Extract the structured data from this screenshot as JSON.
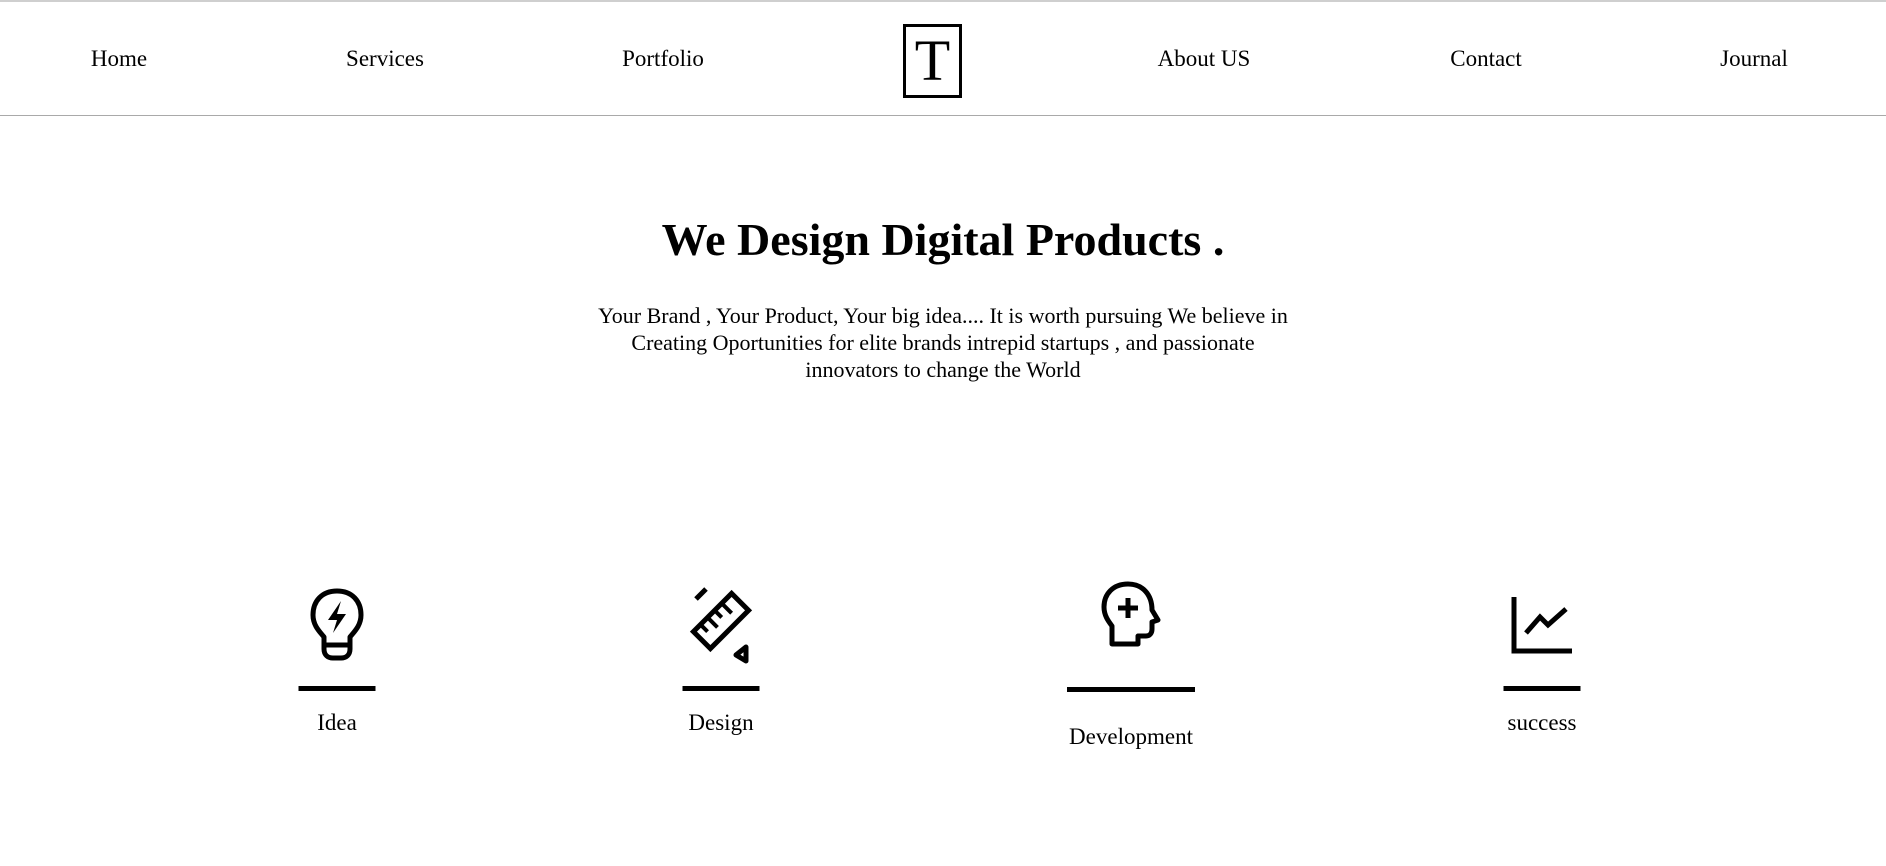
{
  "nav": {
    "left": [
      "Home",
      "Services",
      "Portfolio"
    ],
    "logo": "T",
    "right": [
      "About US",
      "Contact",
      "Journal"
    ]
  },
  "hero": {
    "title": "We Design Digital Products .",
    "text": "Your Brand , Your Product, Your big idea.... It is worth pursuing We believe in Creating Oportunities for elite brands intrepid startups , and passionate innovators to change the World"
  },
  "features": [
    {
      "label": "Idea",
      "icon": "lightbulb-bolt-icon"
    },
    {
      "label": "Design",
      "icon": "ruler-pencil-icon"
    },
    {
      "label": "Development",
      "icon": "head-plus-icon"
    },
    {
      "label": "success",
      "icon": "line-chart-icon"
    }
  ]
}
